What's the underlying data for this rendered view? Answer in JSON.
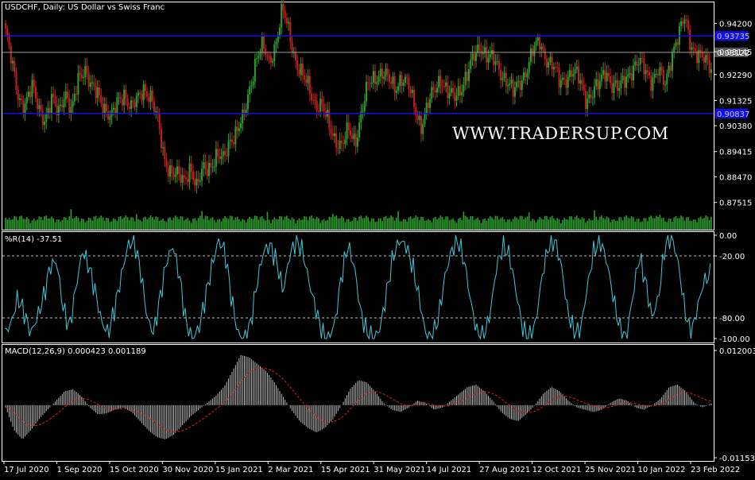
{
  "colors": {
    "background": "#000000",
    "frame": "#ffffff",
    "bull_candle": "#2ea02e",
    "bear_candle": "#c42020",
    "volume": "#2ea02e",
    "level_line": "#1010e0",
    "level_label_bg": "#1010e0",
    "price_line": "#9a9a9a",
    "wpr_line": "#45c7d6",
    "macd_hist": "#bdbdbd",
    "macd_signal": "#e02020",
    "text": "#ffffff"
  },
  "header": {
    "main_title": "USDCHF, Daily:  US Dollar vs Swiss Franc",
    "wpr_title": "%R(14) -37.51",
    "macd_title": "MACD(12,26,9) 0.000423 0.001189"
  },
  "watermark": "WWW.TRADERSUP.COM",
  "chart_data": [
    {
      "type": "candlestick",
      "name": "USDCHF, Daily",
      "y_ticks": [
        "0.94200",
        "0.93145",
        "0.92290",
        "0.91325",
        "0.90380",
        "0.89415",
        "0.88470",
        "0.87515"
      ],
      "ylim": [
        0.8715,
        0.9478
      ],
      "levels": [
        {
          "value": 0.93735,
          "label": "0.93735"
        },
        {
          "value": 0.90837,
          "label": "0.90837"
        }
      ],
      "current_price": {
        "value": 0.93122,
        "label": "0.93122"
      },
      "x_ticks": [
        "17 Jul 2020",
        "1 Sep 2020",
        "15 Oct 2020",
        "30 Nov 2020",
        "15 Jan 2021",
        "2 Mar 2021",
        "15 Apr 2021",
        "31 May 2021",
        "14 Jul 2021",
        "27 Aug 2021",
        "12 Oct 2021",
        "25 Nov 2021",
        "10 Jan 2022",
        "23 Feb 2022"
      ],
      "close_path": [
        0.939,
        0.926,
        0.914,
        0.912,
        0.918,
        0.911,
        0.906,
        0.913,
        0.909,
        0.917,
        0.908,
        0.921,
        0.926,
        0.918,
        0.915,
        0.911,
        0.907,
        0.912,
        0.916,
        0.911,
        0.913,
        0.918,
        0.915,
        0.906,
        0.892,
        0.887,
        0.885,
        0.883,
        0.889,
        0.88,
        0.888,
        0.889,
        0.892,
        0.891,
        0.899,
        0.901,
        0.906,
        0.918,
        0.929,
        0.933,
        0.928,
        0.935,
        0.947,
        0.939,
        0.928,
        0.922,
        0.918,
        0.912,
        0.911,
        0.904,
        0.899,
        0.896,
        0.902,
        0.898,
        0.909,
        0.919,
        0.922,
        0.924,
        0.921,
        0.918,
        0.922,
        0.919,
        0.911,
        0.904,
        0.911,
        0.917,
        0.922,
        0.916,
        0.914,
        0.918,
        0.923,
        0.929,
        0.934,
        0.93,
        0.928,
        0.924,
        0.921,
        0.916,
        0.92,
        0.925,
        0.932,
        0.935,
        0.929,
        0.926,
        0.92,
        0.922,
        0.924,
        0.921,
        0.914,
        0.916,
        0.919,
        0.925,
        0.919,
        0.917,
        0.922,
        0.925,
        0.927,
        0.925,
        0.921,
        0.924,
        0.919,
        0.931,
        0.937,
        0.944,
        0.934,
        0.93,
        0.928,
        0.926
      ]
    },
    {
      "type": "line",
      "name": "%R(14)",
      "y_ticks": [
        "0.00",
        "-20.00",
        "-80.00",
        "-100.00"
      ],
      "ylim": [
        -100,
        0
      ],
      "guide_levels": [
        -20,
        -80
      ],
      "last_value": -37.51,
      "values": [
        -95,
        -85,
        -60,
        -75,
        -95,
        -80,
        -60,
        -30,
        -25,
        -70,
        -90,
        -50,
        -15,
        -30,
        -55,
        -85,
        -95,
        -70,
        -40,
        -10,
        -5,
        -35,
        -80,
        -95,
        -60,
        -25,
        -10,
        -40,
        -85,
        -100,
        -90,
        -60,
        -30,
        -5,
        -15,
        -60,
        -95,
        -100,
        -85,
        -45,
        -15,
        -10,
        -25,
        -55,
        -20,
        -5,
        -15,
        -45,
        -70,
        -95,
        -100,
        -85,
        -40,
        -10,
        -30,
        -75,
        -95,
        -100,
        -90,
        -55,
        -20,
        -5,
        -10,
        -30,
        -60,
        -95,
        -100,
        -80,
        -40,
        -15,
        -5,
        -25,
        -65,
        -95,
        -100,
        -75,
        -30,
        -10,
        -20,
        -55,
        -90,
        -100,
        -85,
        -40,
        -10,
        -5,
        -30,
        -75,
        -95,
        -90,
        -50,
        -15,
        -5,
        -25,
        -60,
        -90,
        -100,
        -60,
        -20,
        -45,
        -80,
        -60,
        -10,
        0,
        -25,
        -70,
        -98,
        -70,
        -45,
        -37.51
      ]
    },
    {
      "type": "bar+line",
      "name": "MACD(12,26,9)",
      "y_ticks": [
        "0.012003",
        "-0.011530"
      ],
      "ylim": [
        -0.01153,
        0.012003
      ],
      "series": [
        {
          "name": "MACD",
          "last_value": 0.000423
        },
        {
          "name": "Signal",
          "last_value": 0.001189
        }
      ],
      "macd_path": [
        -0.0005,
        -0.0055,
        -0.0075,
        -0.0055,
        -0.003,
        -0.001,
        0.001,
        0.003,
        0.0035,
        0.002,
        -0.0005,
        -0.002,
        -0.0018,
        -0.001,
        -0.0005,
        -0.0015,
        -0.0035,
        -0.0055,
        -0.007,
        -0.0075,
        -0.0065,
        -0.0045,
        -0.0025,
        -0.001,
        0.0005,
        0.002,
        0.004,
        0.0075,
        0.011,
        0.0105,
        0.009,
        0.0075,
        0.005,
        0.002,
        -0.001,
        -0.0035,
        -0.005,
        -0.006,
        -0.005,
        -0.003,
        0.0,
        0.0035,
        0.0055,
        0.005,
        0.003,
        0.0005,
        -0.001,
        -0.0015,
        -0.0005,
        0.001,
        0.0005,
        -0.001,
        -0.0005,
        0.001,
        0.0025,
        0.004,
        0.0045,
        0.003,
        0.001,
        -0.0015,
        -0.003,
        -0.0035,
        -0.002,
        0.0,
        0.0025,
        0.004,
        0.003,
        0.001,
        -0.0005,
        -0.001,
        -0.0015,
        -0.001,
        0.0005,
        0.0015,
        0.001,
        -0.0005,
        -0.001,
        0.0,
        0.0015,
        0.004,
        0.0045,
        0.003,
        0.0005,
        -0.0005,
        0.0004
      ]
    }
  ]
}
